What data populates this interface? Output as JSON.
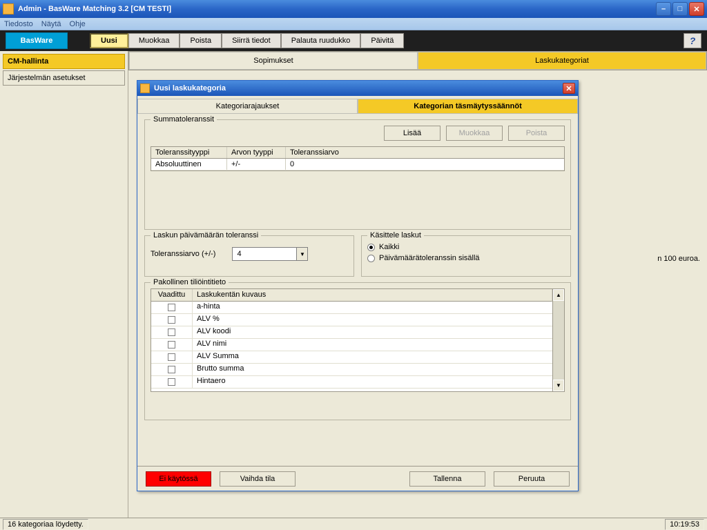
{
  "titlebar": {
    "title": "Admin - BasWare Matching 3.2 [CM TESTI]"
  },
  "menubar": {
    "items": [
      "Tiedosto",
      "Näytä",
      "Ohje"
    ]
  },
  "brand": "BasWare",
  "toolbar": {
    "uusi": "Uusi",
    "muokkaa": "Muokkaa",
    "poista": "Poista",
    "siirra": "Siirrä tiedot",
    "palauta": "Palauta ruudukko",
    "paivita": "Päivitä",
    "help": "?"
  },
  "sidebar": {
    "cm": "CM-hallinta",
    "jarj": "Järjestelmän asetukset"
  },
  "main_tabs": {
    "sopimukset": "Sopimukset",
    "laskukategoriat": "Laskukategoriat"
  },
  "behind_text": "n 100 euroa.",
  "dialog": {
    "title": "Uusi laskukategoria",
    "tabs": {
      "rajaukset": "Kategoriarajaukset",
      "saannot": "Kategorian täsmäytyssäännöt"
    },
    "summ": {
      "legend": "Summatoleranssit",
      "btn_add": "Lisää",
      "btn_edit": "Muokkaa",
      "btn_del": "Poista",
      "head_tt": "Toleranssityyppi",
      "head_at": "Arvon tyyppi",
      "head_tv": "Toleranssiarvo",
      "row": {
        "tt": "Absoluuttinen",
        "at": "+/-",
        "tv": "0"
      }
    },
    "date": {
      "legend": "Laskun päivämäärän toleranssi",
      "label": "Toleranssiarvo (+/-)",
      "value": "4"
    },
    "kasit": {
      "legend": "Käsittele laskut",
      "opt_all": "Kaikki",
      "opt_inside": "Päivämäärätoleranssin sisällä"
    },
    "acct": {
      "legend": "Pakollinen tiliöintitieto",
      "head_va": "Vaadittu",
      "head_lk": "Laskukentän kuvaus",
      "rows": [
        "a-hinta",
        "ALV %",
        "ALV koodi",
        "ALV nimi",
        "ALV Summa",
        "Brutto summa",
        "Hintaero"
      ]
    },
    "footer": {
      "status": "Ei käytössä",
      "vaihda": "Vaihda tila",
      "tallenna": "Tallenna",
      "peruuta": "Peruuta"
    }
  },
  "statusbar": {
    "left": "16 kategoriaa löydetty.",
    "right": "10:19:53"
  }
}
